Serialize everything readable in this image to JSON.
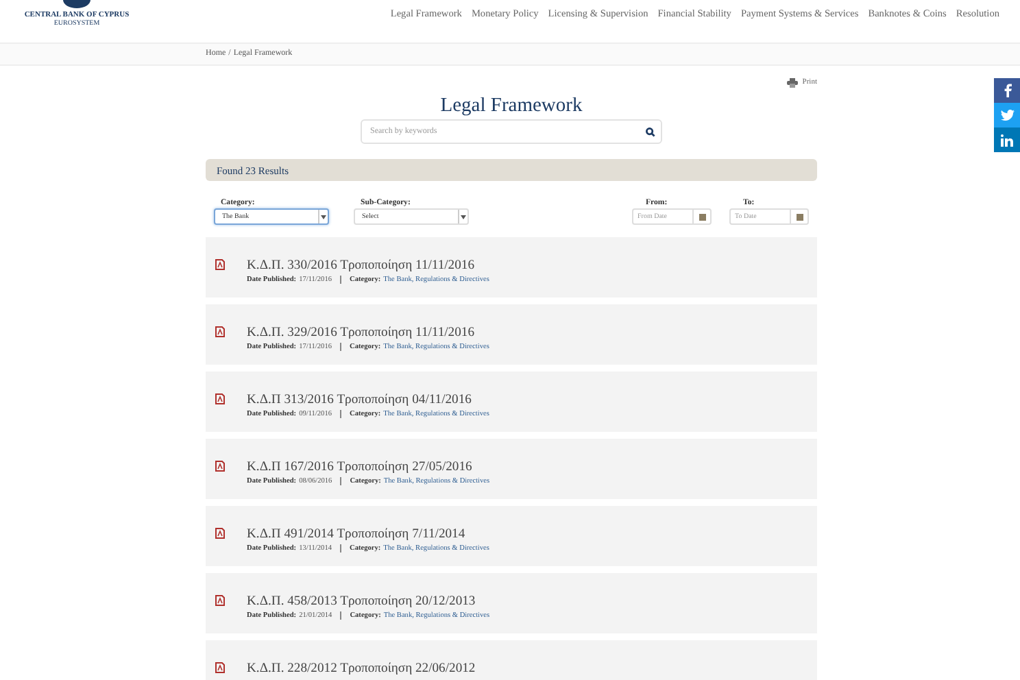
{
  "logo": {
    "name": "CENTRAL BANK OF CYPRUS",
    "tagline": "EUROSYSTEM"
  },
  "nav": [
    "Legal Framework",
    "Monetary Policy",
    "Licensing & Supervision",
    "Financial Stability",
    "Payment Systems & Services",
    "Banknotes & Coins",
    "Resolution"
  ],
  "breadcrumb": {
    "home": "Home",
    "separator": "/",
    "current": "Legal Framework"
  },
  "print": "Print",
  "title": "Legal Framework",
  "search": {
    "placeholder": "Search by keywords"
  },
  "results_bar": "Found 23 Results",
  "filters": {
    "category": {
      "label": "Category:",
      "value": "The Bank"
    },
    "sub_category": {
      "label": "Sub-Category:",
      "value": "Select"
    },
    "from": {
      "label": "From:",
      "placeholder": "From Date"
    },
    "to": {
      "label": "To:",
      "placeholder": "To Date"
    }
  },
  "documents": [
    {
      "title": "Κ.Δ.Π. 330/2016 Τροποποίηση 11/11/2016",
      "date_label": "Date Published:",
      "date": "17/11/2016",
      "category_label": "Category:",
      "category": "The Bank, Regulations & Directives"
    },
    {
      "title": "Κ.Δ.Π. 329/2016 Τροποποίηση 11/11/2016",
      "date_label": "Date Published:",
      "date": "17/11/2016",
      "category_label": "Category:",
      "category": "The Bank, Regulations & Directives"
    },
    {
      "title": "Κ.Δ.Π 313/2016 Τροποποίηση 04/11/2016",
      "date_label": "Date Published:",
      "date": "09/11/2016",
      "category_label": "Category:",
      "category": "The Bank, Regulations & Directives"
    },
    {
      "title": "Κ.Δ.Π 167/2016 Τροποποίηση 27/05/2016",
      "date_label": "Date Published:",
      "date": "08/06/2016",
      "category_label": "Category:",
      "category": "The Bank, Regulations & Directives"
    },
    {
      "title": "Κ.Δ.Π 491/2014 Τροποποίηση 7/11/2014",
      "date_label": "Date Published:",
      "date": "13/11/2014",
      "category_label": "Category:",
      "category": "The Bank, Regulations & Directives"
    },
    {
      "title": "Κ.Δ.Π. 458/2013 Τροποποίηση 20/12/2013",
      "date_label": "Date Published:",
      "date": "21/01/2014",
      "category_label": "Category:",
      "category": "The Bank, Regulations & Directives"
    },
    {
      "title": "Κ.Δ.Π. 228/2012 Τροποποίηση 22/06/2012"
    }
  ],
  "social": [
    {
      "kind": "facebook"
    },
    {
      "kind": "twitter"
    },
    {
      "kind": "linkedin"
    }
  ]
}
